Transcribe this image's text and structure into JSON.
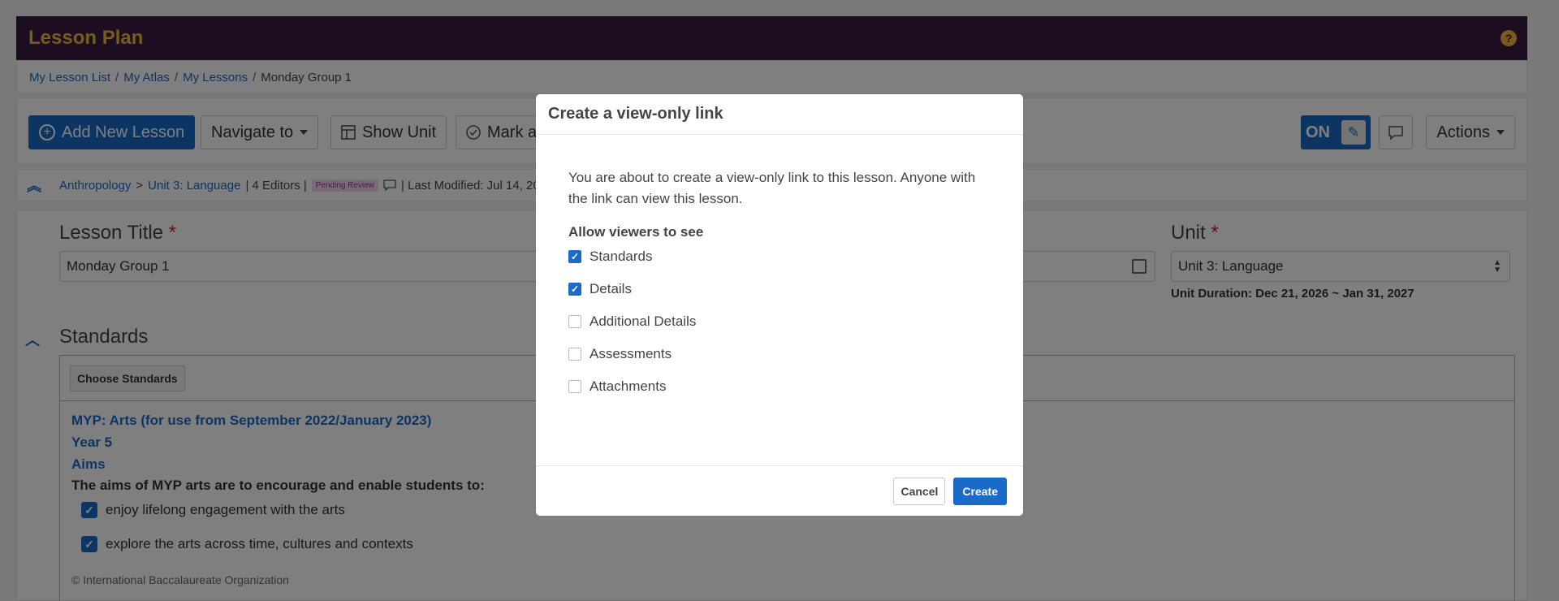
{
  "header": {
    "title": "Lesson Plan",
    "help": "?"
  },
  "breadcrumb": [
    {
      "label": "My Lesson List"
    },
    {
      "label": "My Atlas"
    },
    {
      "label": "My Lessons"
    },
    {
      "label": "Monday Group 1"
    }
  ],
  "breadcrumb_sep": "/",
  "toolbar": {
    "add_new_lesson": "Add New Lesson",
    "navigate_to": "Navigate to",
    "show_unit": "Show Unit",
    "mark": "Mark a",
    "toggle": "ON",
    "actions": "Actions"
  },
  "infobar": {
    "subject": "Anthropology",
    "arrow": ">",
    "unit": "Unit 3: Language",
    "editors": "| 4 Editors |",
    "status": "Pending Review",
    "modified": "| Last Modified: Jul 14, 202"
  },
  "form": {
    "lesson_title_label": "Lesson Title",
    "required_mark": "*",
    "lesson_title_value": "Monday Group 1",
    "unit_label": "Unit",
    "unit_value": "Unit 3: Language",
    "unit_duration": "Unit Duration: Dec 21, 2026 ~ Jan 31, 2027"
  },
  "standards": {
    "title": "Standards",
    "choose_button": "Choose Standards",
    "framework": "MYP: Arts (for use from September 2022/January 2023)",
    "year": "Year 5",
    "section": "Aims",
    "intro": "The aims of MYP arts are to encourage and enable students to:",
    "aims": [
      "enjoy lifelong engagement with the arts",
      "explore the arts across time, cultures and contexts"
    ],
    "copyright": "© International Baccalaureate Organization"
  },
  "modal": {
    "title": "Create a view-only link",
    "description": "You are about to create a view-only link to this lesson. Anyone with the link can view this lesson.",
    "allow_label": "Allow viewers to see",
    "options": [
      {
        "label": "Standards",
        "checked": true
      },
      {
        "label": "Details",
        "checked": true
      },
      {
        "label": "Additional Details",
        "checked": false
      },
      {
        "label": "Assessments",
        "checked": false
      },
      {
        "label": "Attachments",
        "checked": false
      }
    ],
    "cancel": "Cancel",
    "create": "Create"
  },
  "colors": {
    "header_bg": "#3a1a43",
    "header_title": "#f0b73a",
    "primary": "#1a6bc7",
    "badge_bg": "#f4d9ee"
  },
  "icons": {
    "help": "question-circle-icon",
    "add": "plus-circle-icon",
    "show_unit": "layout-icon",
    "mark": "check-circle-icon",
    "toggle": "pencil-icon",
    "comment": "comment-icon",
    "calendar": "calendar-icon",
    "collapse": "chevron-up-icon"
  }
}
